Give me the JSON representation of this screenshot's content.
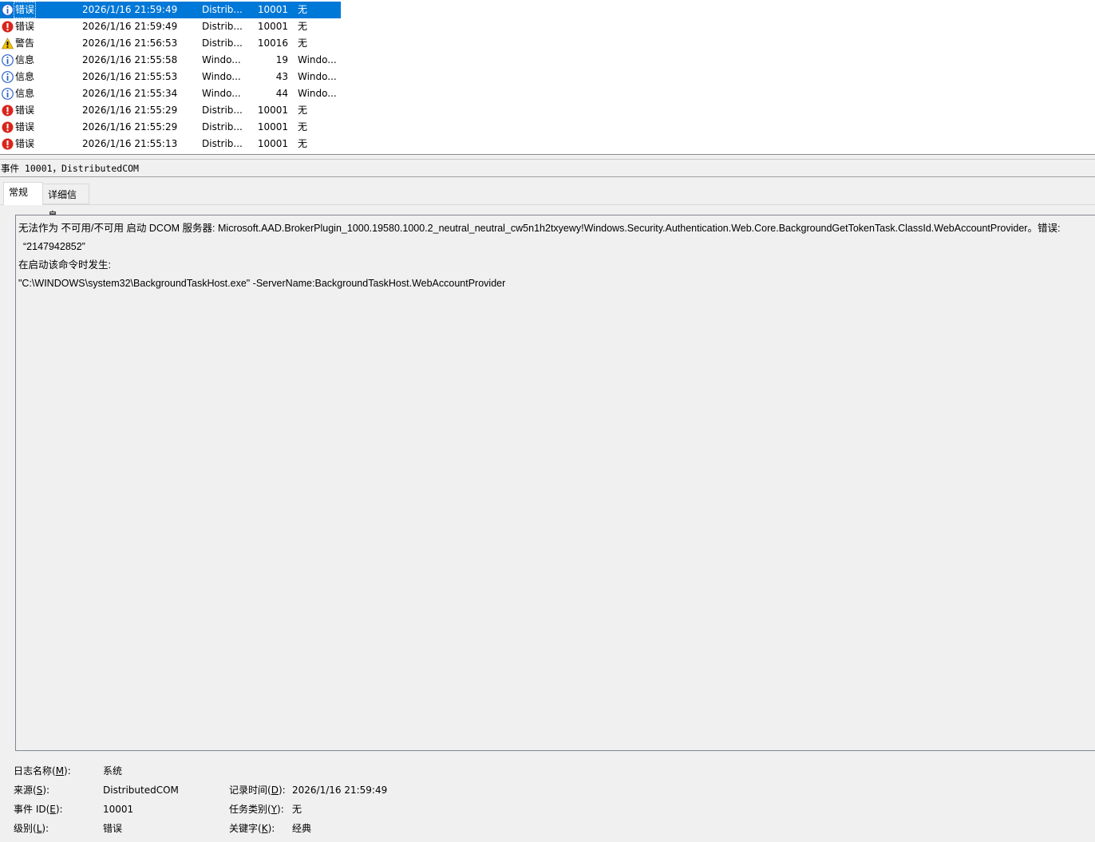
{
  "events": [
    {
      "level": "错误",
      "icon": "info-icon",
      "date": "2026/1/16 21:59:49",
      "source": "Distrib...",
      "id": "10001",
      "category": "无",
      "selected": true
    },
    {
      "level": "错误",
      "icon": "error-icon",
      "date": "2026/1/16 21:59:49",
      "source": "Distrib...",
      "id": "10001",
      "category": "无"
    },
    {
      "level": "警告",
      "icon": "warning-icon",
      "date": "2026/1/16 21:56:53",
      "source": "Distrib...",
      "id": "10016",
      "category": "无"
    },
    {
      "level": "信息",
      "icon": "info-icon",
      "date": "2026/1/16 21:55:58",
      "source": "Windo...",
      "id": "19",
      "category": "Windo..."
    },
    {
      "level": "信息",
      "icon": "info-icon",
      "date": "2026/1/16 21:55:53",
      "source": "Windo...",
      "id": "43",
      "category": "Windo..."
    },
    {
      "level": "信息",
      "icon": "info-icon",
      "date": "2026/1/16 21:55:34",
      "source": "Windo...",
      "id": "44",
      "category": "Windo..."
    },
    {
      "level": "错误",
      "icon": "error-icon",
      "date": "2026/1/16 21:55:29",
      "source": "Distrib...",
      "id": "10001",
      "category": "无"
    },
    {
      "level": "错误",
      "icon": "error-icon",
      "date": "2026/1/16 21:55:29",
      "source": "Distrib...",
      "id": "10001",
      "category": "无"
    },
    {
      "level": "错误",
      "icon": "error-icon",
      "date": "2026/1/16 21:55:13",
      "source": "Distrib...",
      "id": "10001",
      "category": "无"
    }
  ],
  "detail": {
    "header": "事件 10001，DistributedCOM",
    "tabs": {
      "general": "常规",
      "details": "详细信息"
    },
    "description": [
      "无法作为 不可用/不可用 启动 DCOM 服务器: Microsoft.AAD.BrokerPlugin_1000.19580.1000.2_neutral_neutral_cw5n1h2txyewy!Windows.Security.Authentication.Web.Core.BackgroundGetTokenTask.ClassId.WebAccountProvider。错误:",
      "“2147942852”",
      "在启动该命令时发生:",
      "\"C:\\WINDOWS\\system32\\BackgroundTaskHost.exe\" -ServerName:BackgroundTaskHost.WebAccountProvider"
    ],
    "props": {
      "log_name": {
        "label": "日志名称(",
        "key": "M",
        "end": "):",
        "value": "系统"
      },
      "source": {
        "label": "来源(",
        "key": "S",
        "end": "):",
        "value": "DistributedCOM"
      },
      "logged": {
        "label": "记录时间(",
        "key": "D",
        "end": "):",
        "value": "2026/1/16 21:59:49"
      },
      "event_id": {
        "label": "事件 ID(",
        "key": "E",
        "end": "):",
        "value": "10001"
      },
      "task": {
        "label": "任务类别(",
        "key": "Y",
        "end": "):",
        "value": "无"
      },
      "level": {
        "label": "级别(",
        "key": "L",
        "end": "):",
        "value": "错误"
      },
      "keywords": {
        "label": "关键字(",
        "key": "K",
        "end": "):",
        "value": "经典"
      }
    }
  },
  "colors": {
    "selection": "#0078d7",
    "error": "#d9261c",
    "info": "#2c63c9",
    "warning": "#f5c400"
  }
}
